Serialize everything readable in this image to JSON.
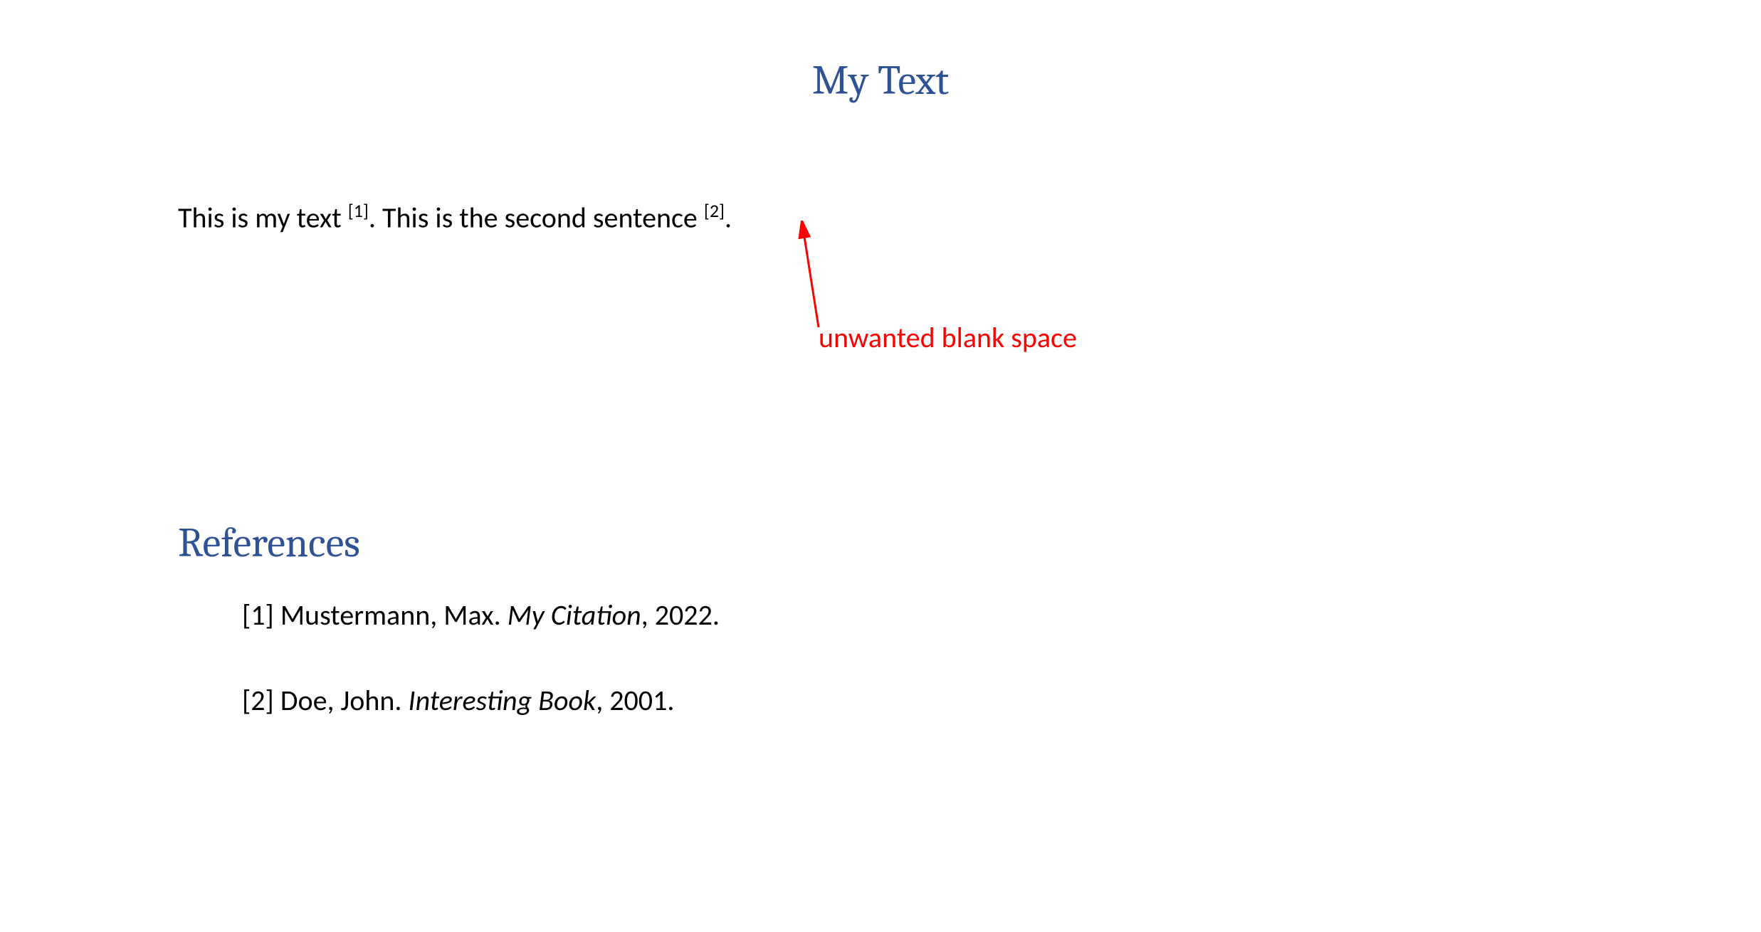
{
  "title": "My Text",
  "body": {
    "part1": "This is my text ",
    "cite1": "[1]",
    "part2": ". This is the second sentence ",
    "cite2": "[2]",
    "part3": "."
  },
  "annotation": {
    "label": "unwanted blank space"
  },
  "references": {
    "heading": "References",
    "items": [
      {
        "num": "[1] ",
        "author": "Mustermann, Max. ",
        "title": "My Citation",
        "suffix": ", 2022."
      },
      {
        "num": "[2] ",
        "author": "Doe, John. ",
        "title": "Interesting Book",
        "suffix": ", 2001."
      }
    ]
  }
}
